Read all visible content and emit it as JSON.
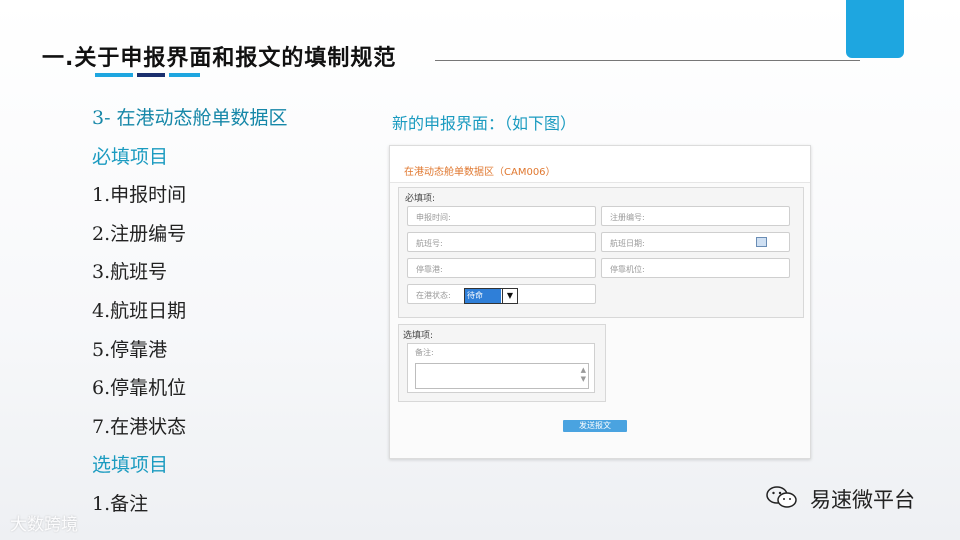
{
  "slide": {
    "title": "一.关于申报界面和报文的填制规范"
  },
  "left_list": {
    "section_heading": "3-  在港动态舱单数据区",
    "required_label": "必填项目",
    "required_items": [
      "1.申报时间",
      "2.注册编号",
      "3.航班号",
      "4.航班日期",
      "5.停靠港",
      "6.停靠机位",
      "7.在港状态"
    ],
    "optional_label": "选填项目",
    "optional_items": [
      "1.备注"
    ]
  },
  "caption": "新的申报界面：（如下图）",
  "form": {
    "title": "在港动态舱单数据区（CAM006）",
    "required_group_label": "必填项:",
    "fields": {
      "report_time": "申报时间:",
      "registration_no": "注册编号:",
      "flight_no": "航班号:",
      "flight_date": "航班日期:",
      "port": "停靠港:",
      "stand": "停靠机位:",
      "status": "在港状态:"
    },
    "status_value": "待命",
    "optional_group_label": "选填项:",
    "remark_label": "备注:",
    "submit_label": "发送报文"
  },
  "brand": {
    "name": "易速微平台",
    "icon": "wechat-icon",
    "watermark": "大数跨境"
  },
  "colors": {
    "accent_blue": "#1ea6e0",
    "navy": "#1a2f6e",
    "heading_cyan": "#1b9bc0",
    "form_title_orange": "#e07830",
    "button_blue": "#4aa3e0"
  }
}
